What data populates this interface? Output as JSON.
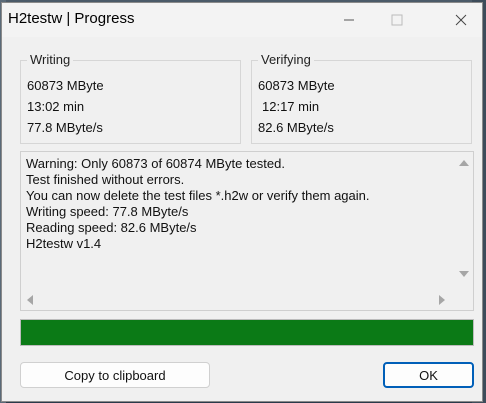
{
  "window": {
    "title": "H2testw | Progress"
  },
  "writing": {
    "legend": "Writing",
    "size": "60873 MByte",
    "time": "13:02 min",
    "speed": "77.8 MByte/s"
  },
  "verifying": {
    "legend": "Verifying",
    "size": "60873 MByte",
    "time": "12:17 min",
    "speed": "82.6 MByte/s"
  },
  "log": {
    "lines": [
      "Warning: Only 60873 of 60874 MByte tested.",
      "Test finished without errors.",
      "You can now delete the test files *.h2w or verify them again.",
      "Writing speed: 77.8 MByte/s",
      "Reading speed: 82.6 MByte/s",
      "H2testw v1.4"
    ]
  },
  "progress": {
    "value_percent": 100,
    "color": "#0b7a16"
  },
  "buttons": {
    "copy_label": "Copy to clipboard",
    "ok_label": "OK"
  },
  "icons": {
    "minimize": "minimize-icon",
    "maximize": "maximize-icon",
    "close": "close-icon"
  }
}
